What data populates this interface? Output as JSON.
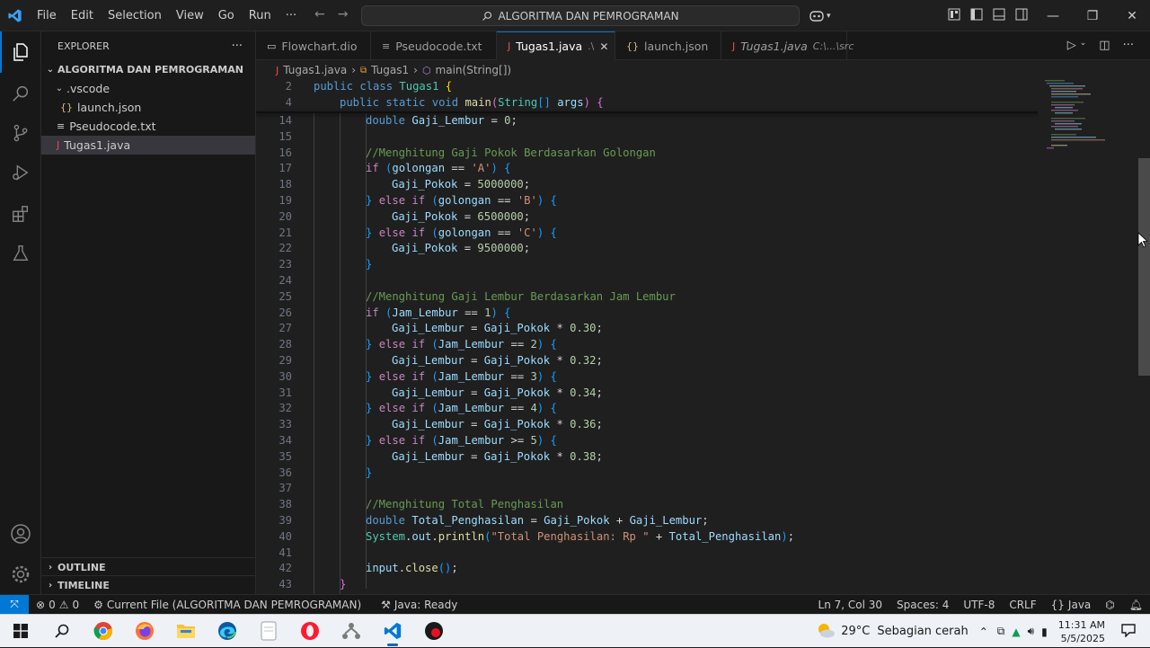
{
  "menu": [
    "File",
    "Edit",
    "Selection",
    "View",
    "Go",
    "Run",
    "···"
  ],
  "search": {
    "text": "ALGORITMA DAN PEMROGRAMAN"
  },
  "sidebar": {
    "title": "EXPLORER",
    "more": "···",
    "root": "ALGORITMA DAN PEMROGRAMAN",
    "items": [
      {
        "label": ".vscode",
        "icon": "chevron-down",
        "depth": 1
      },
      {
        "label": "launch.json",
        "icon": "json",
        "depth": 2
      },
      {
        "label": "Pseudocode.txt",
        "icon": "text-file",
        "depth": 1
      },
      {
        "label": "Tugas1.java",
        "icon": "java",
        "depth": 1,
        "selected": true
      }
    ],
    "outline": "OUTLINE",
    "timeline": "TIMELINE"
  },
  "tabs": [
    {
      "label": "Flowchart.dio",
      "icon": "diagram"
    },
    {
      "label": "Pseudocode.txt",
      "icon": "text-file"
    },
    {
      "label": "Tugas1.java",
      "suffix": ".\\",
      "icon": "java",
      "active": true
    },
    {
      "label": "launch.json",
      "icon": "json"
    },
    {
      "label": "Tugas1.java",
      "suffix": "C:\\...\\src",
      "icon": "java",
      "italic": true
    }
  ],
  "breadcrumb": [
    "Tugas1.java",
    "Tugas1",
    "main(String[])"
  ],
  "code": {
    "sticky": [
      {
        "n": "2",
        "html": "<span class=\"kw\">public</span> <span class=\"kw\">class</span> <span class=\"ty\">Tugas1</span> <span class=\"br1\">{</span>",
        "indent": 1
      },
      {
        "n": "4",
        "html": "<span class=\"kw\">public</span> <span class=\"kw\">static</span> <span class=\"kw\">void</span> <span class=\"fn\">main</span><span class=\"br2\">(</span><span class=\"ty\">String</span><span class=\"br3\">[]</span> <span class=\"vr\">args</span><span class=\"br2\">)</span> <span class=\"br2\">{</span>",
        "indent": 2
      }
    ],
    "lines": [
      {
        "n": "14",
        "html": "<span class=\"kw\">double</span> <span class=\"vr\">Gaji_Lembur</span> <span class=\"tx\">=</span> <span class=\"num\">0</span><span class=\"tx\">;</span>",
        "indent": 3
      },
      {
        "n": "15",
        "html": "",
        "indent": 3
      },
      {
        "n": "16",
        "html": "<span class=\"cm\">//Menghitung Gaji Pokok Berdasarkan Golongan</span>",
        "indent": 3
      },
      {
        "n": "17",
        "html": "<span class=\"ctl\">if</span> <span class=\"br3\">(</span><span class=\"vr\">golongan</span> <span class=\"tx\">==</span> <span class=\"str\">'A'</span><span class=\"br3\">)</span> <span class=\"br3\">{</span>",
        "indent": 3
      },
      {
        "n": "18",
        "html": "<span class=\"vr\">Gaji_Pokok</span> <span class=\"tx\">=</span> <span class=\"num\">5000000</span><span class=\"tx\">;</span>",
        "indent": 4
      },
      {
        "n": "19",
        "html": "<span class=\"br3\">}</span> <span class=\"ctl\">else</span> <span class=\"ctl\">if</span> <span class=\"br3\">(</span><span class=\"vr\">golongan</span> <span class=\"tx\">==</span> <span class=\"str\">'B'</span><span class=\"br3\">)</span> <span class=\"br3\">{</span>",
        "indent": 3
      },
      {
        "n": "20",
        "html": "<span class=\"vr\">Gaji_Pokok</span> <span class=\"tx\">=</span> <span class=\"num\">6500000</span><span class=\"tx\">;</span>",
        "indent": 4
      },
      {
        "n": "21",
        "html": "<span class=\"br3\">}</span> <span class=\"ctl\">else</span> <span class=\"ctl\">if</span> <span class=\"br3\">(</span><span class=\"vr\">golongan</span> <span class=\"tx\">==</span> <span class=\"str\">'C'</span><span class=\"br3\">)</span> <span class=\"br3\">{</span>",
        "indent": 3
      },
      {
        "n": "22",
        "html": "<span class=\"vr\">Gaji_Pokok</span> <span class=\"tx\">=</span> <span class=\"num\">9500000</span><span class=\"tx\">;</span>",
        "indent": 4
      },
      {
        "n": "23",
        "html": "<span class=\"br3\">}</span>",
        "indent": 3
      },
      {
        "n": "24",
        "html": "",
        "indent": 3
      },
      {
        "n": "25",
        "html": "<span class=\"cm\">//Menghitung Gaji Lembur Berdasarkan Jam Lembur</span>",
        "indent": 3
      },
      {
        "n": "26",
        "html": "<span class=\"ctl\">if</span> <span class=\"br3\">(</span><span class=\"vr\">Jam_Lembur</span> <span class=\"tx\">==</span> <span class=\"num\">1</span><span class=\"br3\">)</span> <span class=\"br3\">{</span>",
        "indent": 3
      },
      {
        "n": "27",
        "html": "<span class=\"vr\">Gaji_Lembur</span> <span class=\"tx\">=</span> <span class=\"vr\">Gaji_Pokok</span> <span class=\"tx\">*</span> <span class=\"num\">0.30</span><span class=\"tx\">;</span>",
        "indent": 4
      },
      {
        "n": "28",
        "html": "<span class=\"br3\">}</span> <span class=\"ctl\">else</span> <span class=\"ctl\">if</span> <span class=\"br3\">(</span><span class=\"vr\">Jam_Lembur</span> <span class=\"tx\">==</span> <span class=\"num\">2</span><span class=\"br3\">)</span> <span class=\"br3\">{</span>",
        "indent": 3
      },
      {
        "n": "29",
        "html": "<span class=\"vr\">Gaji_Lembur</span> <span class=\"tx\">=</span> <span class=\"vr\">Gaji_Pokok</span> <span class=\"tx\">*</span> <span class=\"num\">0.32</span><span class=\"tx\">;</span>",
        "indent": 4
      },
      {
        "n": "30",
        "html": "<span class=\"br3\">}</span> <span class=\"ctl\">else</span> <span class=\"ctl\">if</span> <span class=\"br3\">(</span><span class=\"vr\">Jam_Lembur</span> <span class=\"tx\">==</span> <span class=\"num\">3</span><span class=\"br3\">)</span> <span class=\"br3\">{</span>",
        "indent": 3
      },
      {
        "n": "31",
        "html": "<span class=\"vr\">Gaji_Lembur</span> <span class=\"tx\">=</span> <span class=\"vr\">Gaji_Pokok</span> <span class=\"tx\">*</span> <span class=\"num\">0.34</span><span class=\"tx\">;</span>",
        "indent": 4
      },
      {
        "n": "32",
        "html": "<span class=\"br3\">}</span> <span class=\"ctl\">else</span> <span class=\"ctl\">if</span> <span class=\"br3\">(</span><span class=\"vr\">Jam_Lembur</span> <span class=\"tx\">==</span> <span class=\"num\">4</span><span class=\"br3\">)</span> <span class=\"br3\">{</span>",
        "indent": 3
      },
      {
        "n": "33",
        "html": "<span class=\"vr\">Gaji_Lembur</span> <span class=\"tx\">=</span> <span class=\"vr\">Gaji_Pokok</span> <span class=\"tx\">*</span> <span class=\"num\">0.36</span><span class=\"tx\">;</span>",
        "indent": 4
      },
      {
        "n": "34",
        "html": "<span class=\"br3\">}</span> <span class=\"ctl\">else</span> <span class=\"ctl\">if</span> <span class=\"br3\">(</span><span class=\"vr\">Jam_Lembur</span> <span class=\"tx\">&gt;=</span> <span class=\"num\">5</span><span class=\"br3\">)</span> <span class=\"br3\">{</span>",
        "indent": 3
      },
      {
        "n": "35",
        "html": "<span class=\"vr\">Gaji_Lembur</span> <span class=\"tx\">=</span> <span class=\"vr\">Gaji_Pokok</span> <span class=\"tx\">*</span> <span class=\"num\">0.38</span><span class=\"tx\">;</span>",
        "indent": 4
      },
      {
        "n": "36",
        "html": "<span class=\"br3\">}</span>",
        "indent": 3
      },
      {
        "n": "37",
        "html": "",
        "indent": 3
      },
      {
        "n": "38",
        "html": "<span class=\"cm\">//Menghitung Total Penghasilan</span>",
        "indent": 3
      },
      {
        "n": "39",
        "html": "<span class=\"kw\">double</span> <span class=\"vr\">Total_Penghasilan</span> <span class=\"tx\">=</span> <span class=\"vr\">Gaji_Pokok</span> <span class=\"tx\">+</span> <span class=\"vr\">Gaji_Lembur</span><span class=\"tx\">;</span>",
        "indent": 3
      },
      {
        "n": "40",
        "html": "<span class=\"ty\">System</span><span class=\"tx\">.</span><span class=\"vr\">out</span><span class=\"tx\">.</span><span class=\"fn\">println</span><span class=\"br3\">(</span><span class=\"str\">\"Total Penghasilan: Rp \"</span> <span class=\"tx\">+</span> <span class=\"vr\">Total_Penghasilan</span><span class=\"br3\">)</span><span class=\"tx\">;</span>",
        "indent": 3
      },
      {
        "n": "41",
        "html": "",
        "indent": 3
      },
      {
        "n": "42",
        "html": "<span class=\"vr\">input</span><span class=\"tx\">.</span><span class=\"fn\">close</span><span class=\"br3\">()</span><span class=\"tx\">;</span>",
        "indent": 3
      },
      {
        "n": "43",
        "html": "<span class=\"br2\">}</span>",
        "indent": 2
      }
    ]
  },
  "status": {
    "remote": "⤧",
    "problems_errors": "0",
    "problems_warnings": "0",
    "current_file": "Current File (ALGORITMA DAN PEMROGRAMAN)",
    "java_status": "Java: Ready",
    "position": "Ln 7, Col 30",
    "spaces": "Spaces: 4",
    "encoding": "UTF-8",
    "eol": "CRLF",
    "language": "Java"
  },
  "taskbar": {
    "weather_temp": "29°C",
    "weather_desc": "Sebagian cerah",
    "time": "11:31 AM",
    "date": "5/5/2025"
  },
  "colors": {
    "accent": "#0078d4",
    "editor_bg": "#1f1f1f",
    "sidebar_bg": "#181818"
  }
}
